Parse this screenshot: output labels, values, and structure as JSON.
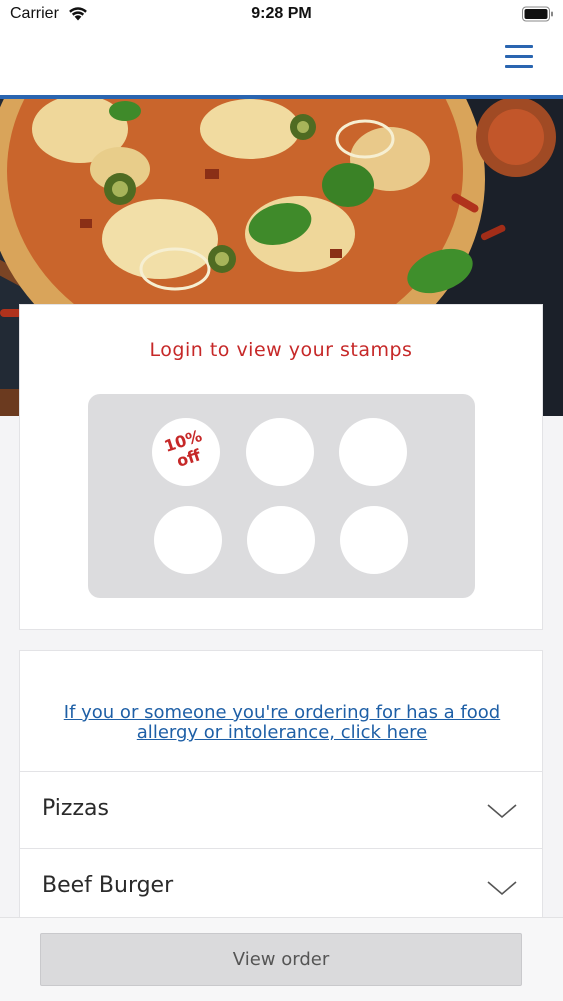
{
  "status_bar": {
    "carrier": "Carrier",
    "time": "9:28 PM",
    "wifi_icon": "wifi-icon",
    "battery_icon": "battery-icon"
  },
  "nav": {
    "menu_icon": "hamburger-menu-icon",
    "accent_color": "#2a65b0"
  },
  "hero": {
    "image": "pizza-photo"
  },
  "stamps": {
    "title": "Login to view your stamps",
    "title_color": "#c62828",
    "items": [
      {
        "label": "10%\noff"
      },
      {
        "label": ""
      },
      {
        "label": ""
      },
      {
        "label": ""
      },
      {
        "label": ""
      },
      {
        "label": ""
      }
    ]
  },
  "menu": {
    "allergy_link": "If you or someone you're ordering for has a food allergy or intolerance, click here",
    "link_color": "#1e5fa6",
    "categories": [
      {
        "label": "Pizzas",
        "icon": "chevron-down-icon"
      },
      {
        "label": "Beef Burger",
        "icon": "chevron-down-icon"
      }
    ]
  },
  "footer": {
    "view_order_label": "View order"
  }
}
